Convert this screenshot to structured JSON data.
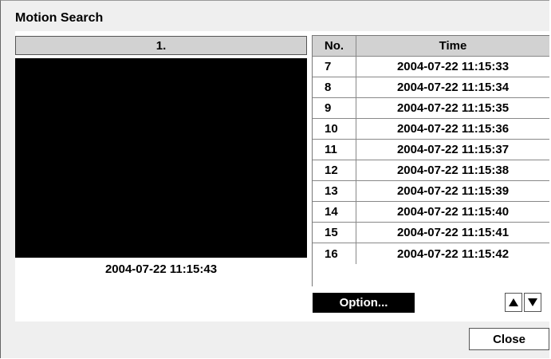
{
  "dialog": {
    "title": "Motion Search",
    "camera_header": "1.",
    "frame_timestamp": "2004-07-22  11:15:43",
    "table": {
      "headers": {
        "no": "No.",
        "time": "Time"
      },
      "rows": [
        {
          "no": "7",
          "time": "2004-07-22  11:15:33"
        },
        {
          "no": "8",
          "time": "2004-07-22  11:15:34"
        },
        {
          "no": "9",
          "time": "2004-07-22  11:15:35"
        },
        {
          "no": "10",
          "time": "2004-07-22  11:15:36"
        },
        {
          "no": "11",
          "time": "2004-07-22  11:15:37"
        },
        {
          "no": "12",
          "time": "2004-07-22  11:15:38"
        },
        {
          "no": "13",
          "time": "2004-07-22  11:15:39"
        },
        {
          "no": "14",
          "time": "2004-07-22  11:15:40"
        },
        {
          "no": "15",
          "time": "2004-07-22  11:15:41"
        },
        {
          "no": "16",
          "time": "2004-07-22  11:15:42"
        }
      ]
    },
    "option_label": "Option...",
    "close_label": "Close",
    "icons": {
      "up": "up-arrow-icon",
      "down": "down-arrow-icon"
    }
  }
}
